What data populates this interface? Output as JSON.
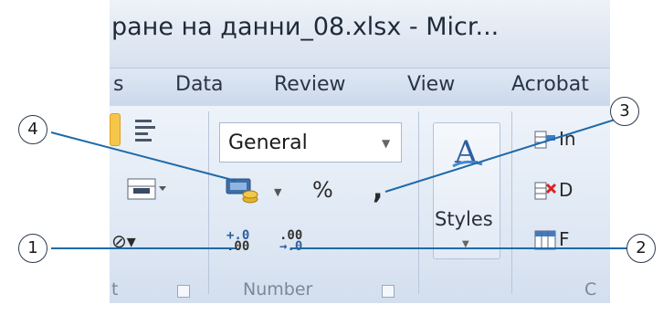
{
  "window": {
    "title": "ране на данни_08.xlsx  -  Micr..."
  },
  "menu": {
    "items": [
      "s",
      "Data",
      "Review",
      "View",
      "Acrobat"
    ]
  },
  "ribbon": {
    "number_format_combo": {
      "value": "General"
    },
    "percent_label": "%",
    "comma_label": ",",
    "increase_decimal": {
      "top": "+.0",
      "bottom": ".00"
    },
    "decrease_decimal": {
      "top": ".00",
      "bottom": "→.0"
    },
    "number_group_label": "Number",
    "prev_group_label": "t",
    "styles_label": "Styles",
    "cells_items": [
      "In",
      "D",
      "F"
    ],
    "cells_group_label": "C"
  },
  "callouts": [
    "1",
    "2",
    "3",
    "4"
  ],
  "colors": {
    "callout_line": "#1e6aa8",
    "callout_circle_border": "#2d3a4a"
  }
}
